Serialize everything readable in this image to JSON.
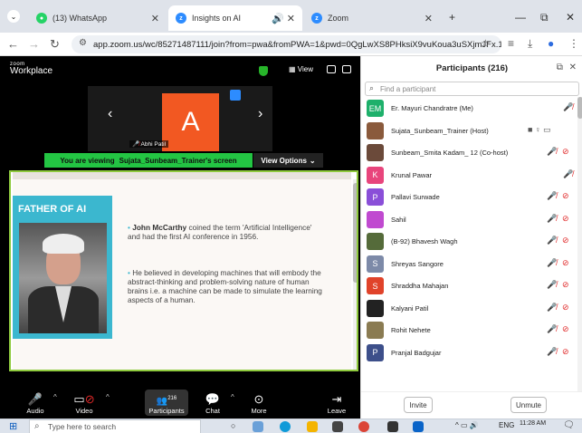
{
  "browser": {
    "tabs": [
      {
        "title": "(13) WhatsApp",
        "icon_color": "#25d366"
      },
      {
        "title": "Insights on AI",
        "icon_color": "#2d8cff"
      },
      {
        "title": "Zoom",
        "icon_color": "#2d8cff"
      }
    ],
    "url": "app.zoom.us/wc/85271487111/join?from=pwa&fromPWA=1&pwd=0QgLwXS8PHksiX9vuKoua3uSXjmJFx.1"
  },
  "zoom": {
    "logo_top": "zoom",
    "logo_bottom": "Workplace",
    "view_label": "View",
    "active_speaker": {
      "initial": "A",
      "name": "Abhi Patil"
    },
    "viewing_prefix": "You are viewing",
    "viewing_name": "Sujata_Sunbeam_Trainer's screen",
    "view_options_label": "View Options",
    "participant_count_badge": "216",
    "toolbar": {
      "audio": "Audio",
      "video": "Video",
      "participants": "Participants",
      "chat": "Chat",
      "more": "More",
      "leave": "Leave"
    }
  },
  "slide": {
    "title": "FATHER OF AI",
    "bullet1_bold": "John McCarthy",
    "bullet1_rest": " coined the term 'Artificial Intelligence' and had the first AI conference in 1956.",
    "bullet2": "He believed in developing machines that will embody the abstract-thinking and problem-solving nature of human brains i.e. a machine can be made to simulate the learning aspects of a human."
  },
  "participants": {
    "header": "Participants (216)",
    "search_placeholder": "Find a participant",
    "list": [
      {
        "name": "Er. Mayuri Chandratre (Me)",
        "initials": "EM",
        "color": "#1eb06b"
      },
      {
        "name": "Sujata_Sunbeam_Trainer (Host)",
        "initials": "",
        "color": "#8a5a3c"
      },
      {
        "name": "Sunbeam_Smita Kadam_ 12 (Co-host)",
        "initials": "",
        "color": "#6b4a3a"
      },
      {
        "name": "Krunal Pawar",
        "initials": "K",
        "color": "#e8457c"
      },
      {
        "name": "Pallavi Surwade",
        "initials": "P",
        "color": "#8a4fd8"
      },
      {
        "name": "Sahil",
        "initials": "",
        "color": "#c04ad0"
      },
      {
        "name": "(B-92) Bhavesh Wagh",
        "initials": "",
        "color": "#556b3a"
      },
      {
        "name": "Shreyas Sangore",
        "initials": "S",
        "color": "#7d8aa8"
      },
      {
        "name": "Shraddha Mahajan",
        "initials": "S",
        "color": "#e0432a"
      },
      {
        "name": "Kalyani Patil",
        "initials": "",
        "color": "#222222"
      },
      {
        "name": "Rohit Nehete",
        "initials": "",
        "color": "#8a7b52"
      },
      {
        "name": "Pranjal Badgujar",
        "initials": "P",
        "color": "#3d4f8a"
      }
    ],
    "invite_label": "Invite",
    "unmute_label": "Unmute"
  },
  "taskbar": {
    "search_placeholder": "Type here to search",
    "lang": "ENG",
    "time": "11:28 AM"
  }
}
